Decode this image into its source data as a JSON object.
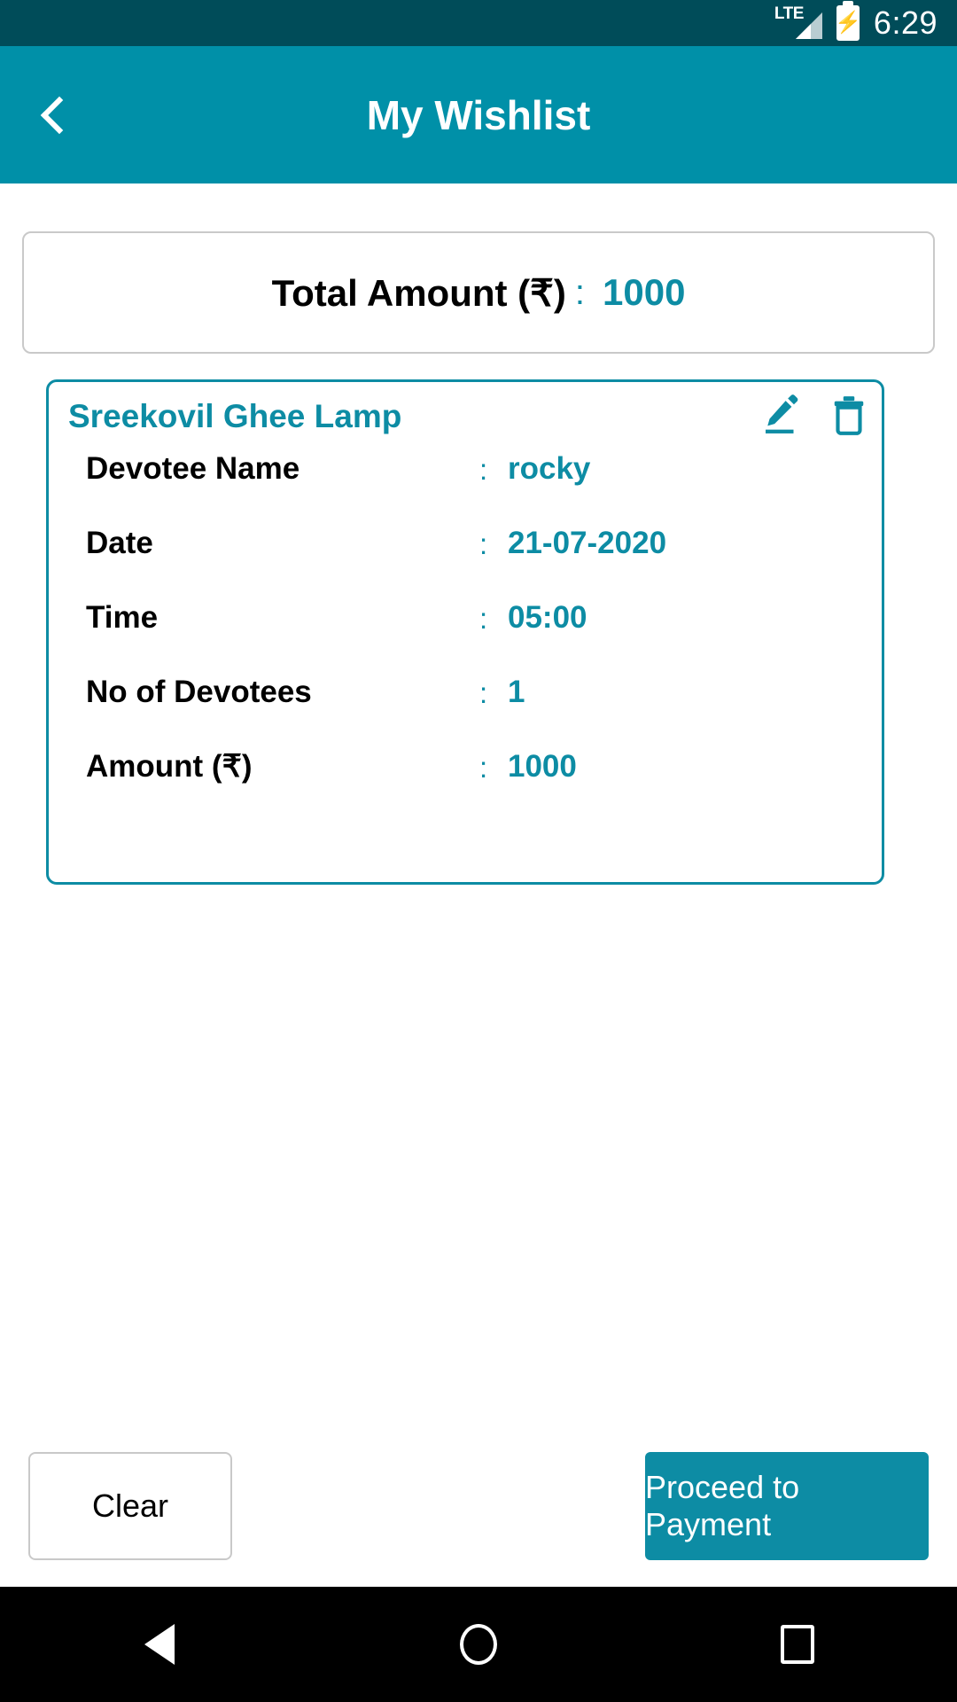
{
  "status_bar": {
    "network_label": "LTE",
    "network_icon": "signal-bars-icon",
    "battery_icon": "battery-charging-icon",
    "time": "6:29",
    "background_color": "#004C59"
  },
  "app_bar": {
    "back_icon": "chevron-left-icon",
    "title": "My Wishlist",
    "background_color": "#0090A8"
  },
  "total_card": {
    "label": "Total Amount (₹)",
    "separator": ":",
    "value": "1000"
  },
  "item_card": {
    "title": "Sreekovil Ghee Lamp",
    "edit_icon": "pencil-edit-icon",
    "delete_icon": "trash-delete-icon",
    "accent_color": "#0D8CA4",
    "rows": [
      {
        "label": "Devotee Name",
        "separator": ":",
        "value": "rocky"
      },
      {
        "label": "Date",
        "separator": ":",
        "value": "21-07-2020"
      },
      {
        "label": "Time",
        "separator": ":",
        "value": "05:00"
      },
      {
        "label": "No of Devotees",
        "separator": ":",
        "value": "1"
      },
      {
        "label": "Amount (₹)",
        "separator": ":",
        "value": "1000"
      }
    ]
  },
  "footer": {
    "clear_label": "Clear",
    "pay_label": "Proceed to Payment",
    "pay_color": "#0D8CA4"
  },
  "nav_bar": {
    "back_icon": "nav-back-triangle-icon",
    "home_icon": "nav-home-circle-icon",
    "recents_icon": "nav-recents-square-icon"
  }
}
